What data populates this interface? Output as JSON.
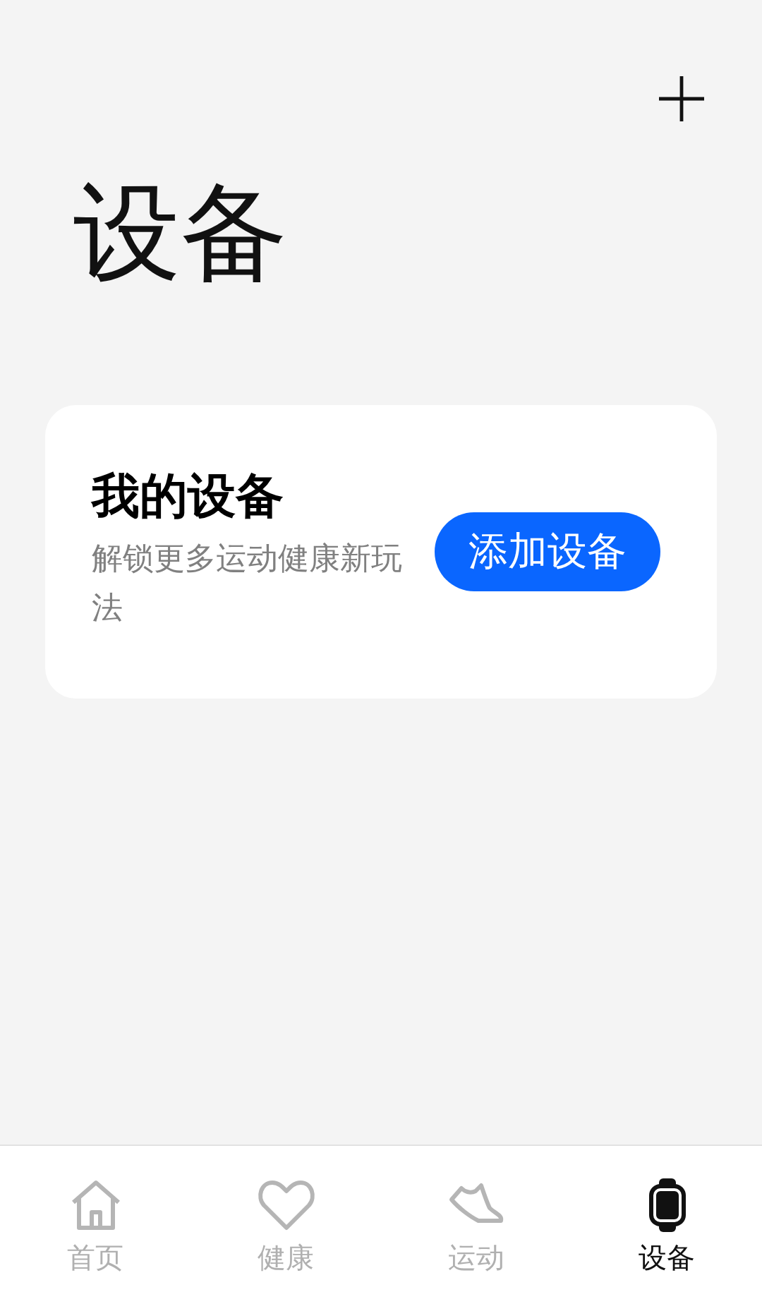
{
  "page": {
    "title": "设备"
  },
  "card": {
    "title": "我的设备",
    "subtitle": "解锁更多运动健康新玩法",
    "button": "添加设备"
  },
  "tabs": [
    {
      "kind": "home",
      "label": "首页",
      "selected": false
    },
    {
      "kind": "heart",
      "label": "健康",
      "selected": false
    },
    {
      "kind": "shoe",
      "label": "运动",
      "selected": false
    },
    {
      "kind": "watch",
      "label": "设备",
      "selected": true
    }
  ]
}
